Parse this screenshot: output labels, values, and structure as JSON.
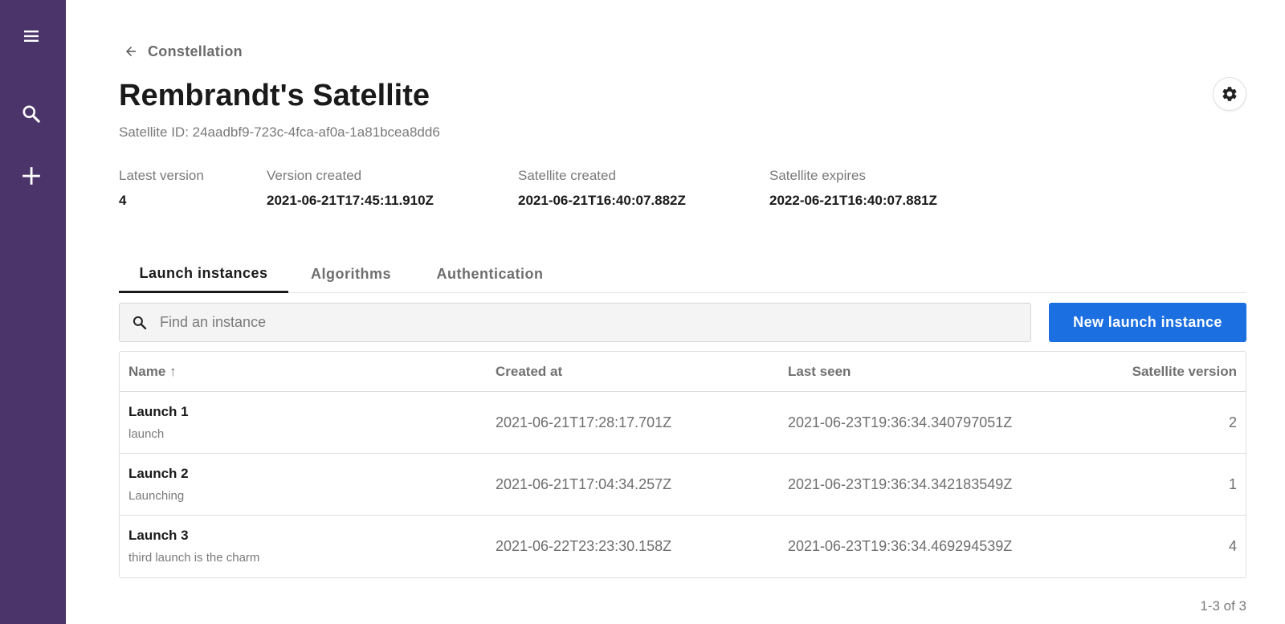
{
  "nav": {
    "menu_icon": "menu-icon",
    "search_icon": "search-icon",
    "add_icon": "plus-icon"
  },
  "breadcrumb": {
    "back_label": "Constellation"
  },
  "header": {
    "title": "Rembrandt's Satellite",
    "satellite_id": "Satellite ID: 24aadbf9-723c-4fca-af0a-1a81bcea8dd6"
  },
  "meta": [
    {
      "label": "Latest version",
      "value": "4"
    },
    {
      "label": "Version created",
      "value": "2021-06-21T17:45:11.910Z"
    },
    {
      "label": "Satellite created",
      "value": "2021-06-21T16:40:07.882Z"
    },
    {
      "label": "Satellite expires",
      "value": "2022-06-21T16:40:07.881Z"
    }
  ],
  "tabs": [
    {
      "label": "Launch instances",
      "active": true
    },
    {
      "label": "Algorithms",
      "active": false
    },
    {
      "label": "Authentication",
      "active": false
    }
  ],
  "search": {
    "placeholder": "Find an instance",
    "value": ""
  },
  "new_button_label": "New launch instance",
  "table": {
    "columns": [
      "Name ↑",
      "Created at",
      "Last seen",
      "Satellite version"
    ],
    "rows": [
      {
        "name": "Launch 1",
        "description": "launch",
        "created_at": "2021-06-21T17:28:17.701Z",
        "last_seen": "2021-06-23T19:36:34.340797051Z",
        "version": "2"
      },
      {
        "name": "Launch 2",
        "description": "Launching",
        "created_at": "2021-06-21T17:04:34.257Z",
        "last_seen": "2021-06-23T19:36:34.342183549Z",
        "version": "1"
      },
      {
        "name": "Launch 3",
        "description": "third launch is the charm",
        "created_at": "2021-06-22T23:23:30.158Z",
        "last_seen": "2021-06-23T19:36:34.469294539Z",
        "version": "4"
      }
    ]
  },
  "pagination": "1-3 of 3",
  "colors": {
    "sidebar": "#4b3469",
    "primary_button": "#1b6fe0"
  }
}
